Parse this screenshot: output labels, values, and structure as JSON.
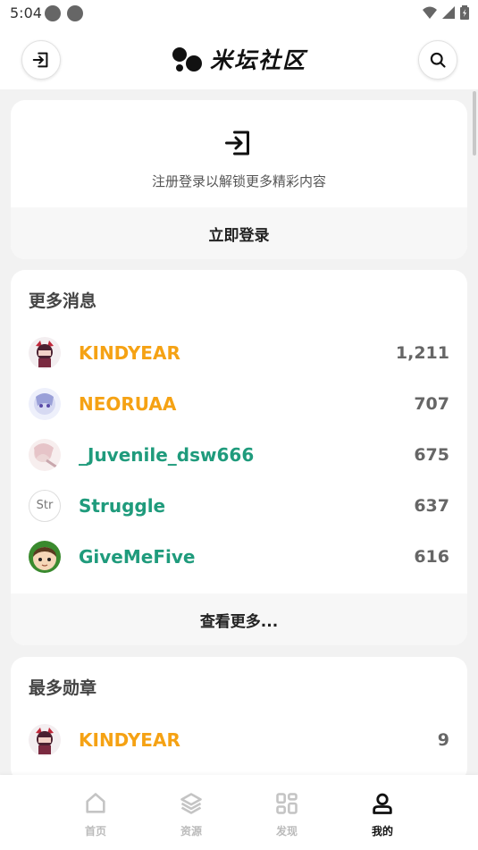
{
  "status_bar": {
    "time": "5:04"
  },
  "header": {
    "app_title": "米坛社区"
  },
  "login_card": {
    "subtitle": "注册登录以解锁更多精彩内容",
    "login_button": "立即登录"
  },
  "messages_card": {
    "title": "更多消息",
    "users": [
      {
        "name": "KINDYEAR",
        "count": "1,211",
        "color": "#f5a214"
      },
      {
        "name": "NEORUAA",
        "count": "707",
        "color": "#f5a214"
      },
      {
        "name": "_Juvenile_dsw666",
        "count": "675",
        "color": "#1f9b7c"
      },
      {
        "name": "Struggle",
        "count": "637",
        "color": "#1f9b7c",
        "avatar_text": "Str"
      },
      {
        "name": "GiveMeFive",
        "count": "616",
        "color": "#1f9b7c"
      }
    ],
    "more_button": "查看更多..."
  },
  "medals_card": {
    "title": "最多勋章",
    "users": [
      {
        "name": "KINDYEAR",
        "count": "9",
        "color": "#f5a214"
      }
    ]
  },
  "bottom_nav": {
    "items": [
      {
        "label": "首页",
        "icon": "home-icon",
        "active": false
      },
      {
        "label": "资源",
        "icon": "layers-icon",
        "active": false
      },
      {
        "label": "发现",
        "icon": "grid-icon",
        "active": false
      },
      {
        "label": "我的",
        "icon": "person-icon",
        "active": true
      }
    ]
  }
}
